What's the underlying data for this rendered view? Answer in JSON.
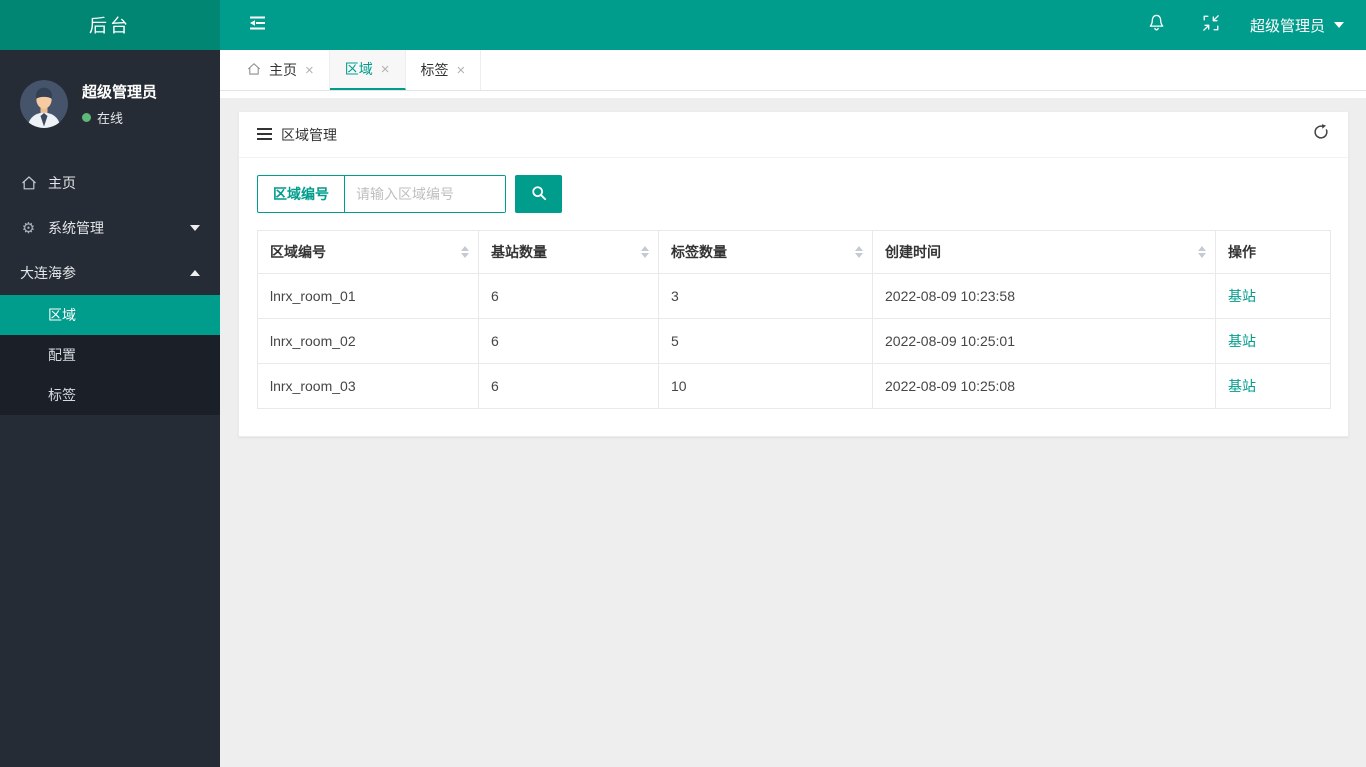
{
  "topbar": {
    "logo_title": "后台",
    "username": "超级管理员"
  },
  "sidebar": {
    "user": {
      "name": "超级管理员",
      "status": "在线"
    },
    "items": [
      {
        "label": "主页",
        "icon": "home-icon"
      },
      {
        "label": "系统管理",
        "icon": "gear-icon",
        "chevron": "down"
      },
      {
        "label": "大连海参",
        "chevron": "up"
      }
    ],
    "submenu": [
      {
        "label": "区域",
        "active": true
      },
      {
        "label": "配置",
        "active": false
      },
      {
        "label": "标签",
        "active": false
      }
    ]
  },
  "tabs": [
    {
      "label": "主页",
      "icon": "home-icon",
      "active": false
    },
    {
      "label": "区域",
      "active": true
    },
    {
      "label": "标签",
      "active": false
    }
  ],
  "panel": {
    "title": "区域管理"
  },
  "search": {
    "field_label": "区域编号",
    "placeholder": "请输入区域编号",
    "value": ""
  },
  "table": {
    "columns": [
      "区域编号",
      "基站数量",
      "标签数量",
      "创建时间",
      "操作"
    ],
    "sortable_columns": [
      true,
      true,
      true,
      true,
      false
    ],
    "rows": [
      [
        "lnrx_room_01",
        "6",
        "3",
        "2022-08-09 10:23:58",
        "基站"
      ],
      [
        "lnrx_room_02",
        "6",
        "5",
        "2022-08-09 10:25:01",
        "基站"
      ],
      [
        "lnrx_room_03",
        "6",
        "10",
        "2022-08-09 10:25:08",
        "基站"
      ]
    ]
  },
  "colors": {
    "accent": "#009c8c",
    "logo_bg": "#008673",
    "sidebar_bg": "#262c35",
    "submenu_bg": "#1b2028",
    "online_dot": "#5fb878",
    "content_bg": "#eeeeee"
  }
}
